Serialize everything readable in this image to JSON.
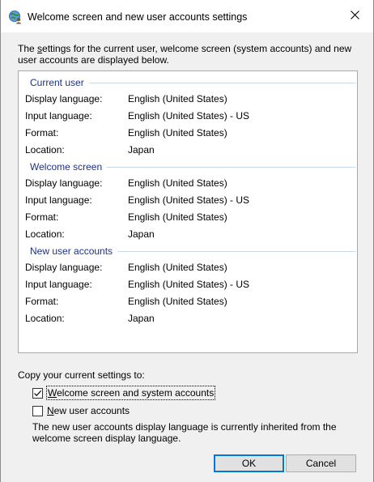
{
  "window": {
    "title": "Welcome screen and new user accounts settings",
    "close_glyph": "✕"
  },
  "intro": {
    "mnemonic": "s",
    "text_before": "The ",
    "text_after": "ettings for the current user, welcome screen (system accounts) and new user accounts are displayed below."
  },
  "sections": [
    {
      "title": "Current user",
      "rows": [
        {
          "label": "Display language:",
          "value": "English (United States)"
        },
        {
          "label": "Input language:",
          "value": "English (United States) - US"
        },
        {
          "label": "Format:",
          "value": "English (United States)"
        },
        {
          "label": "Location:",
          "value": "Japan"
        }
      ]
    },
    {
      "title": "Welcome screen",
      "rows": [
        {
          "label": "Display language:",
          "value": "English (United States)"
        },
        {
          "label": "Input language:",
          "value": "English (United States) - US"
        },
        {
          "label": "Format:",
          "value": "English (United States)"
        },
        {
          "label": "Location:",
          "value": "Japan"
        }
      ]
    },
    {
      "title": "New user accounts",
      "rows": [
        {
          "label": "Display language:",
          "value": "English (United States)"
        },
        {
          "label": "Input language:",
          "value": "English (United States) - US"
        },
        {
          "label": "Format:",
          "value": "English (United States)"
        },
        {
          "label": "Location:",
          "value": "Japan"
        }
      ]
    }
  ],
  "copy": {
    "label": "Copy your current settings to:",
    "welcome_checkbox": {
      "mnemonic": "W",
      "rest": "elcome screen and system accounts",
      "checked": true
    },
    "new_user_checkbox": {
      "mnemonic": "N",
      "rest": "ew user accounts",
      "checked": false
    },
    "note": "The new user accounts display language is currently inherited from the welcome screen display language."
  },
  "buttons": {
    "ok": "OK",
    "cancel": "Cancel"
  },
  "icons": {
    "title": "globe-user-icon",
    "close": "close-icon",
    "check": "checkmark-icon"
  },
  "colors": {
    "section_title": "#1e3287",
    "section_line": "#c9d7ea",
    "default_button_border": "#0078d7",
    "dialog_background": "#f0f0f0"
  }
}
